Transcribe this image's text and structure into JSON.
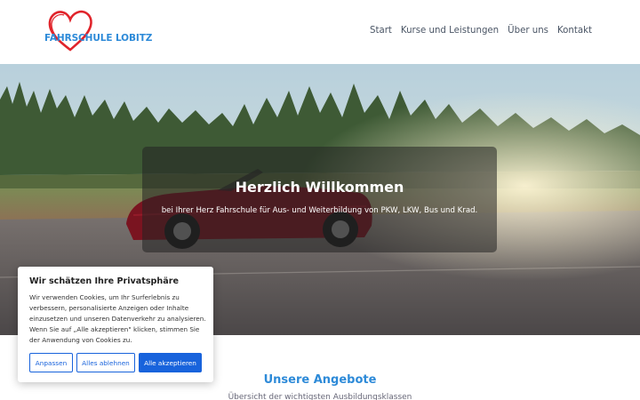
{
  "header": {
    "logo_text": "FAHRSCHULE LOBITZ",
    "nav": [
      {
        "label": "Start",
        "name": "nav-start"
      },
      {
        "label": "Kurse und Leistungen",
        "name": "nav-kurse"
      },
      {
        "label": "Über uns",
        "name": "nav-ueber-uns"
      },
      {
        "label": "Kontakt",
        "name": "nav-kontakt"
      }
    ]
  },
  "hero": {
    "title": "Herzlich Willkommen",
    "subtitle": "bei Ihrer Herz Fahrschule für Aus- und Weiterbildung von PKW, LKW, Bus und Krad."
  },
  "section": {
    "title": "Unsere Angebote",
    "subtitle": "Übersicht der wichtigsten Ausbildungsklassen"
  },
  "cookie": {
    "title": "Wir schätzen Ihre Privatsphäre",
    "text": "Wir verwenden Cookies, um Ihr Surferlebnis zu verbessern, personalisierte Anzeigen oder Inhalte einzusetzen und unseren Datenverkehr zu analysieren. Wenn Sie auf „Alle akzeptieren\" klicken, stimmen Sie der Anwendung von Cookies zu.",
    "customize_label": "Anpassen",
    "reject_label": "Alles ablehnen",
    "accept_label": "Alle akzeptieren"
  },
  "colors": {
    "brand_blue": "#2d8ad8",
    "logo_heart": "#e0242b",
    "cookie_button": "#1863dc"
  }
}
